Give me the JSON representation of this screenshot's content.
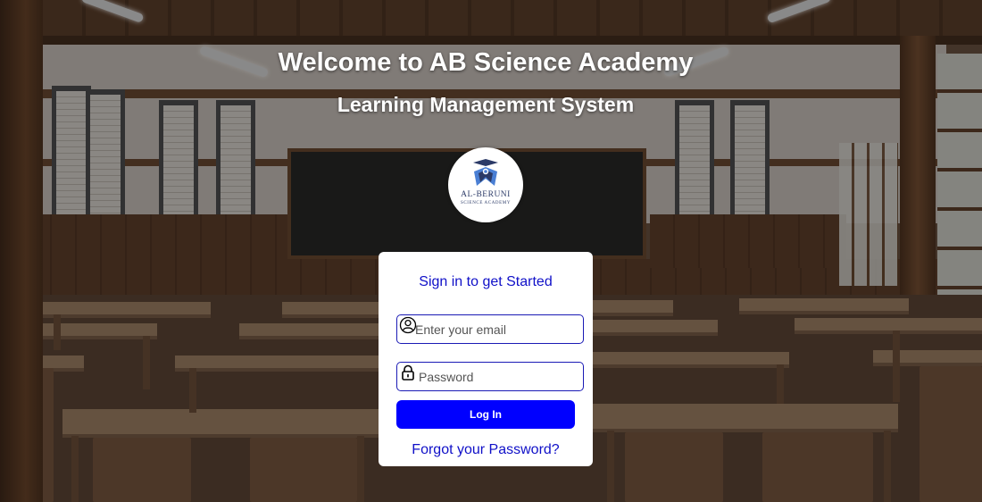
{
  "header": {
    "title": "Welcome to AB Science Academy",
    "subtitle": "Learning Management System"
  },
  "logo": {
    "name": "AL-BERUNI",
    "tagline": "SCIENCE ACADEMY",
    "color": "#2b3a67"
  },
  "login": {
    "heading": "Sign in to get Started",
    "email_placeholder": "Enter your email",
    "email_value": "",
    "email_icon": "user-icon",
    "password_placeholder": "Password",
    "password_value": "",
    "password_icon": "lock-icon",
    "login_label": "Log In",
    "forgot_label": "Forgot your Password?"
  },
  "colors": {
    "accent": "#0000ff",
    "link": "#1010c8",
    "card": "#ffffff"
  }
}
